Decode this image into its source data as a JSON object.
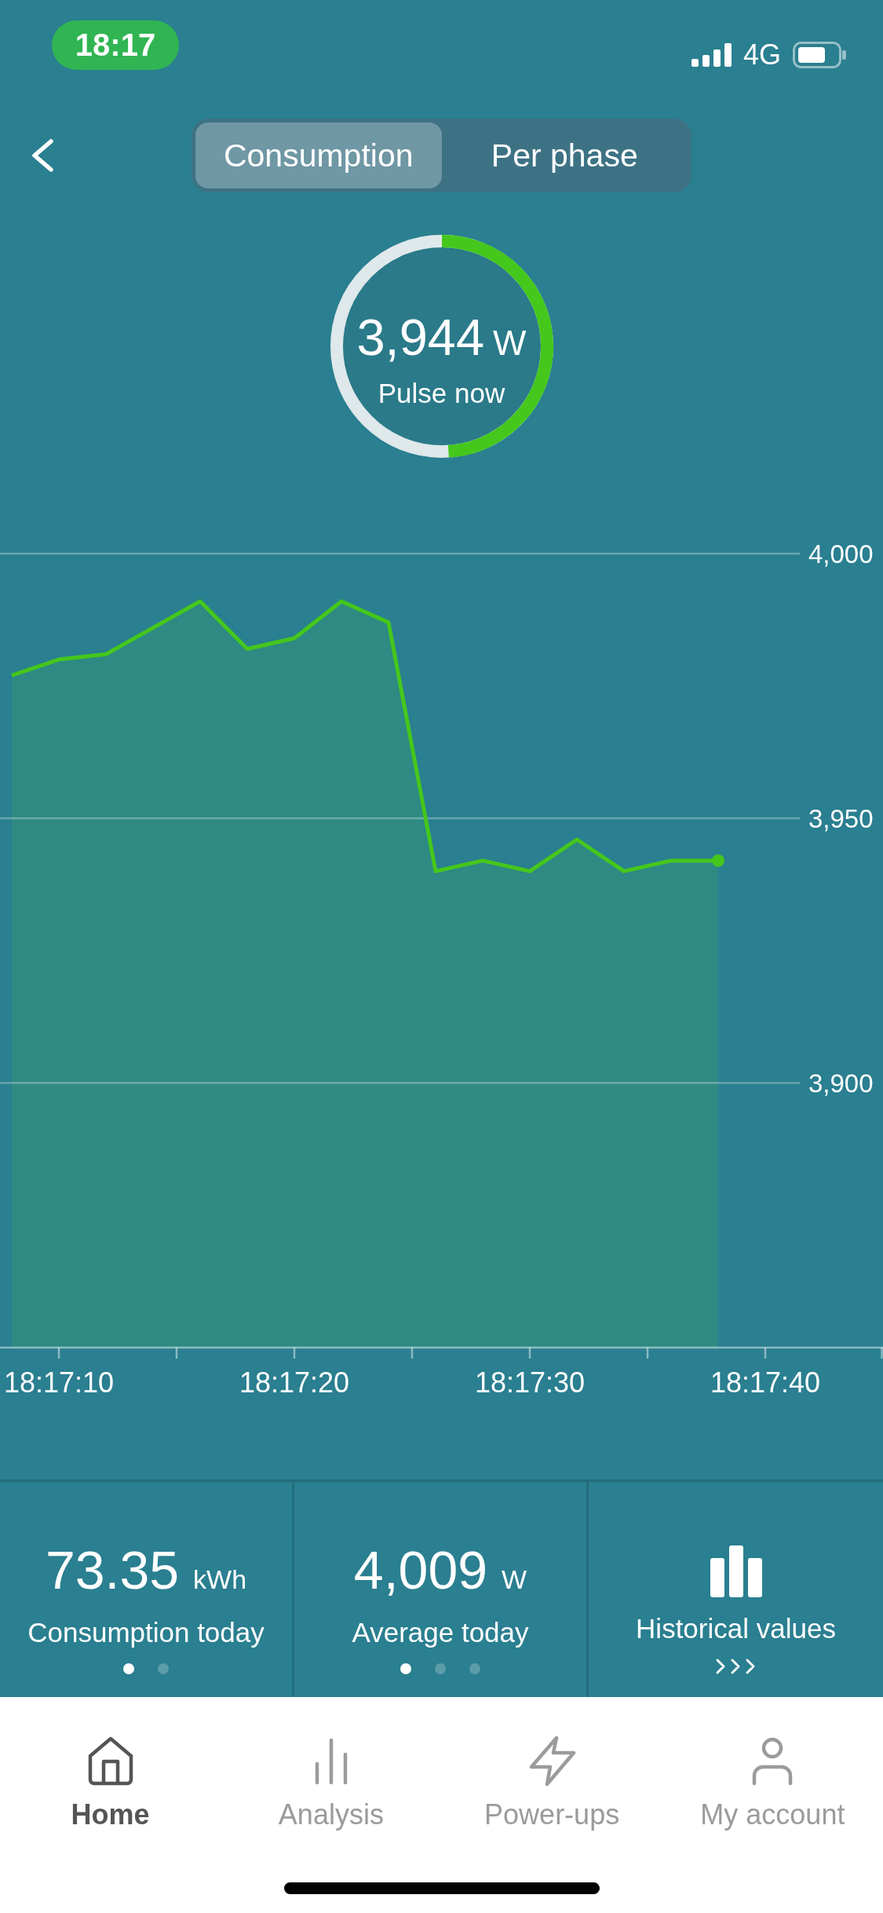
{
  "status_bar": {
    "time": "18:17",
    "network": "4G"
  },
  "header": {
    "segments": [
      {
        "label": "Consumption",
        "selected": true
      },
      {
        "label": "Per phase",
        "selected": false
      }
    ]
  },
  "gauge": {
    "value": "3,944",
    "unit": "W",
    "label": "Pulse now",
    "level": 0.49
  },
  "chart": {
    "chart_data": {
      "type": "area",
      "categories": [
        null,
        "18:17:10",
        null,
        null,
        null,
        null,
        "18:17:20",
        null,
        null,
        null,
        null,
        "18:17:30",
        null,
        null,
        null,
        null,
        "18:17:40"
      ],
      "values": [
        3977,
        3980,
        3981,
        3986,
        3991,
        3982,
        3984,
        3991,
        3987,
        3940,
        3942,
        3940,
        3946,
        3940,
        3942,
        3942,
        null
      ],
      "ylim": [
        3850,
        4000
      ],
      "yticks": [
        {
          "value": 3900,
          "label": "3,900"
        },
        {
          "value": 3950,
          "label": "3,950"
        },
        {
          "value": 4000,
          "label": "4,000"
        }
      ],
      "grid": true
    }
  },
  "stats": [
    {
      "kind": "metric",
      "value": "73.35",
      "unit": "kWh",
      "label": "Consumption today",
      "pages": [
        {
          "selected": true
        },
        {
          "selected": false
        }
      ]
    },
    {
      "kind": "metric",
      "value": "4,009",
      "unit": "W",
      "label": "Average today",
      "pages": [
        {
          "selected": true
        },
        {
          "selected": false
        },
        {
          "selected": false
        }
      ]
    },
    {
      "kind": "link",
      "label": "Historical values"
    }
  ],
  "tab_bar": [
    {
      "label": "Home",
      "selected": true
    },
    {
      "label": "Analysis",
      "selected": false
    },
    {
      "label": "Power-ups",
      "selected": false
    },
    {
      "label": "My account",
      "selected": false
    }
  ]
}
